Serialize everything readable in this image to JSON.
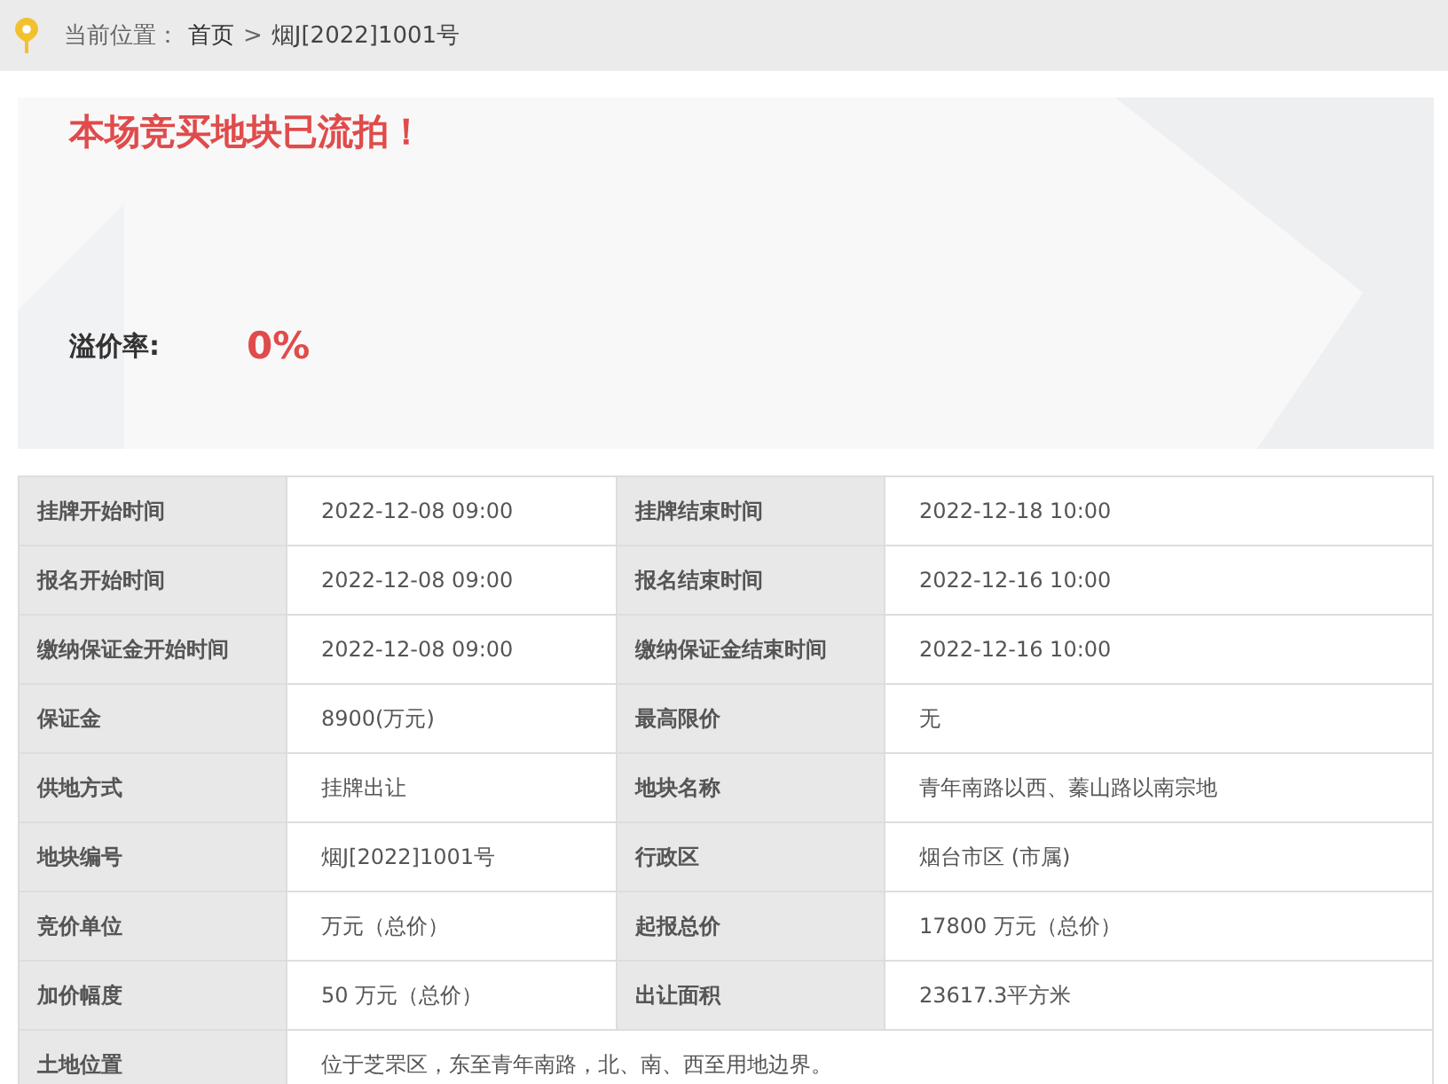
{
  "breadcrumb": {
    "label": "当前位置：",
    "items": [
      {
        "text": "首页",
        "kind": "link"
      },
      {
        "text": ">",
        "kind": "separator"
      },
      {
        "text": "烟J[2022]1001号",
        "kind": "current"
      }
    ]
  },
  "banner": {
    "status": "本场竞买地块已流拍！",
    "premium_label": "溢价率:",
    "premium_value": "0%"
  },
  "table": {
    "rows": [
      [
        {
          "label": "挂牌开始时间",
          "value": "2022-12-08 09:00"
        },
        {
          "label": "挂牌结束时间",
          "value": "2022-12-18 10:00"
        }
      ],
      [
        {
          "label": "报名开始时间",
          "value": "2022-12-08 09:00"
        },
        {
          "label": "报名结束时间",
          "value": "2022-12-16 10:00"
        }
      ],
      [
        {
          "label": "缴纳保证金开始时间",
          "value": "2022-12-08 09:00"
        },
        {
          "label": "缴纳保证金结束时间",
          "value": "2022-12-16 10:00"
        }
      ],
      [
        {
          "label": "保证金",
          "value": "8900(万元)"
        },
        {
          "label": "最高限价",
          "value": "无"
        }
      ],
      [
        {
          "label": "供地方式",
          "value": "挂牌出让"
        },
        {
          "label": "地块名称",
          "value": "青年南路以西、蓁山路以南宗地"
        }
      ],
      [
        {
          "label": "地块编号",
          "value": "烟J[2022]1001号"
        },
        {
          "label": "行政区",
          "value": "烟台市区 (市属)"
        }
      ],
      [
        {
          "label": "竞价单位",
          "value": "万元（总价）"
        },
        {
          "label": "起报总价",
          "value": "17800 万元（总价）"
        }
      ],
      [
        {
          "label": "加价幅度",
          "value": "50 万元（总价）"
        },
        {
          "label": "出让面积",
          "value": "23617.3平方米"
        }
      ],
      [
        {
          "label": "土地位置",
          "value": "位于芝罘区，东至青年南路，北、南、西至用地边界。"
        }
      ]
    ]
  }
}
